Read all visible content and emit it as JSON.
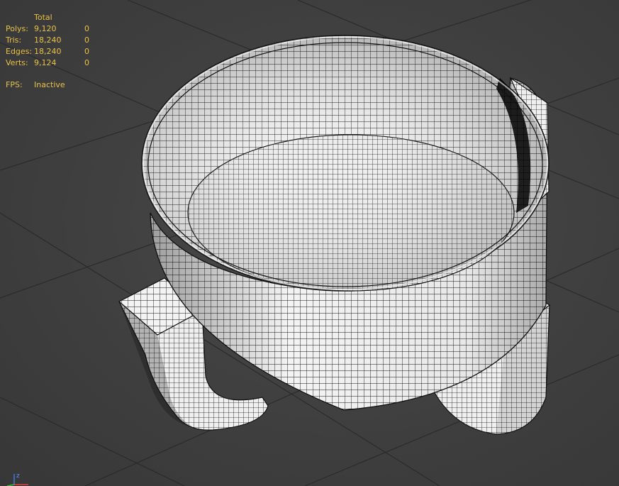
{
  "viewport": {
    "background": "#3d3d3d",
    "stats": {
      "header_total": "Total",
      "rows": [
        {
          "label": "Polys:",
          "total": "9,120",
          "selected": "0"
        },
        {
          "label": "Tris:",
          "total": "18,240",
          "selected": "0"
        },
        {
          "label": "Edges:",
          "total": "18,240",
          "selected": "0"
        },
        {
          "label": "Verts:",
          "total": "9,124",
          "selected": "0"
        }
      ],
      "fps_label": "FPS:",
      "fps_value": "Inactive",
      "text_color": "#e8c14a"
    },
    "axis_gizmo": {
      "z_label": "z",
      "icon": "axis-tripod-icon"
    },
    "model": {
      "icon": "wireframe-bowl-model",
      "grid_color": "#2a2a2a",
      "surface_color": "#f2f2f2"
    }
  }
}
